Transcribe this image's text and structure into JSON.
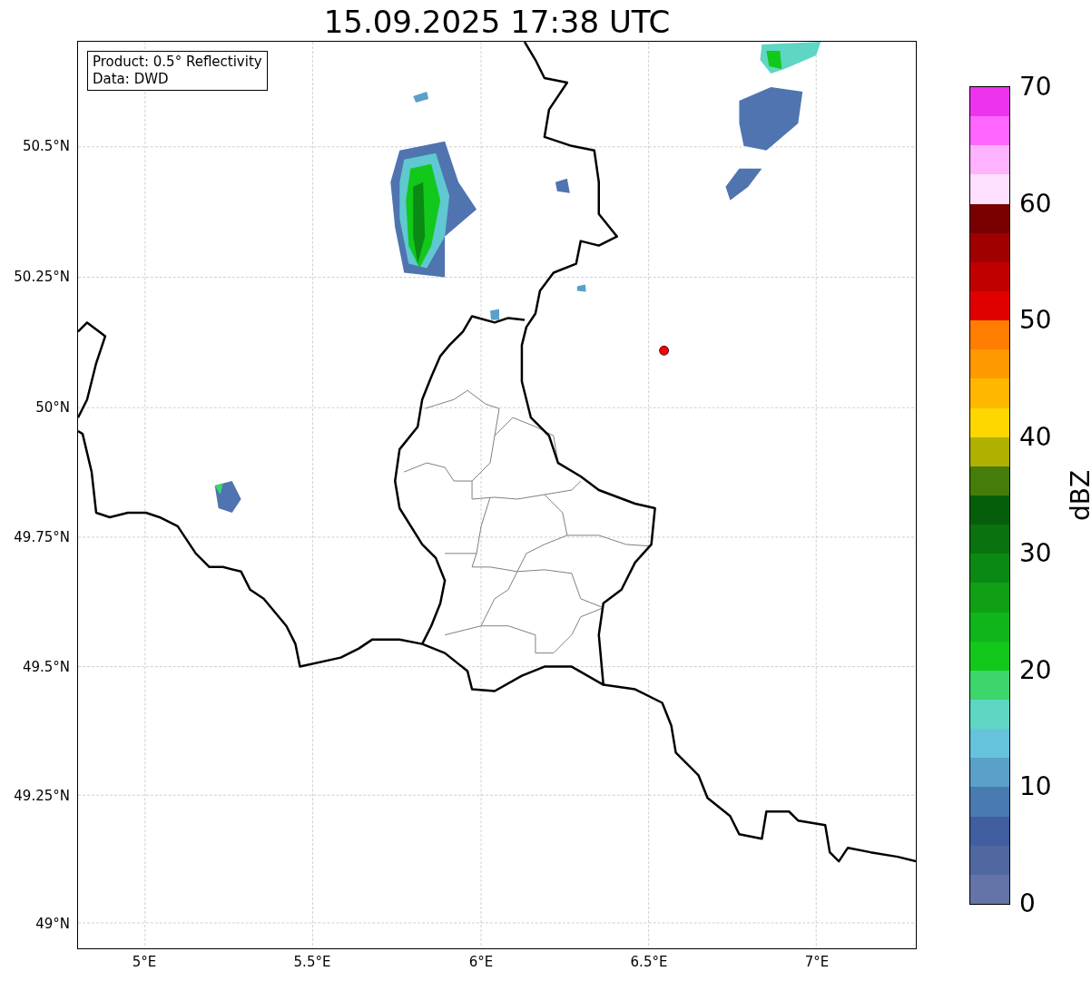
{
  "title": "15.09.2025 17:38 UTC",
  "info_box": [
    "Product: 0.5° Reflectivity",
    "Data: DWD"
  ],
  "lat_labels": [
    "50.5°N",
    "50.25°N",
    "50°N",
    "49.75°N",
    "49.5°N",
    "49.25°N",
    "49°N"
  ],
  "lon_labels": [
    "5°E",
    "5.5°E",
    "6°E",
    "6.5°E",
    "7°E"
  ],
  "colorbar": {
    "label": "dBZ",
    "ticks": [
      "70",
      "60",
      "50",
      "40",
      "30",
      "20",
      "10",
      "0"
    ],
    "segments": [
      {
        "color": "#ee33ee"
      },
      {
        "color": "#ff66ff"
      },
      {
        "color": "#ffb3ff"
      },
      {
        "color": "#ffe0ff"
      },
      {
        "color": "#780000"
      },
      {
        "color": "#a00000"
      },
      {
        "color": "#c00000"
      },
      {
        "color": "#e00000"
      },
      {
        "color": "#ff7d00"
      },
      {
        "color": "#ff9900"
      },
      {
        "color": "#ffb700"
      },
      {
        "color": "#ffd700"
      },
      {
        "color": "#b0b000"
      },
      {
        "color": "#467d0a"
      },
      {
        "color": "#055f0a"
      },
      {
        "color": "#0a720f"
      },
      {
        "color": "#0a8a14"
      },
      {
        "color": "#0fa014"
      },
      {
        "color": "#10b51a"
      },
      {
        "color": "#12c81a"
      },
      {
        "color": "#3cd66d"
      },
      {
        "color": "#5fd6c4"
      },
      {
        "color": "#66c3dc"
      },
      {
        "color": "#5aa0c8"
      },
      {
        "color": "#4a7ab2"
      },
      {
        "color": "#405ea0"
      },
      {
        "color": "#5068a0"
      },
      {
        "color": "#6474a8"
      }
    ]
  }
}
